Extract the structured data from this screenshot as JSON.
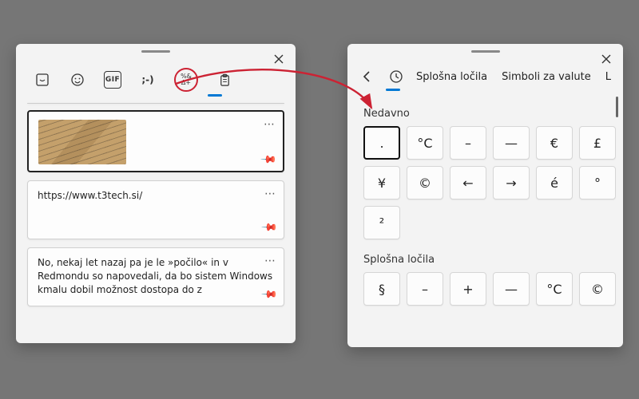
{
  "left": {
    "tabs": {
      "sticker": "❐",
      "emoji": "☺",
      "gif": "GIF",
      "kaomoji": ";-)",
      "symbols": "%&\nΔ+",
      "clipboard": "📋"
    },
    "clips": [
      {
        "type": "image"
      },
      {
        "type": "text",
        "text": "https://www.t3tech.si/"
      },
      {
        "type": "text",
        "text": "No, nekaj let nazaj pa je le »počilo« in v Redmondu so napovedali, da bo sistem Windows kmalu dobil možnost dostopa do z"
      }
    ]
  },
  "right": {
    "categories": [
      "Splošna ločila",
      "Simboli za valute",
      "L"
    ],
    "sections": [
      {
        "title": "Nedavno",
        "keys": [
          ".",
          "°C",
          "–",
          "—",
          "€",
          "£",
          "¥",
          "©",
          "←",
          "→",
          "é",
          "°",
          "²"
        ]
      },
      {
        "title": "Splošna ločila",
        "keys": [
          "§",
          "–",
          "+",
          "—",
          "°C",
          "©"
        ]
      }
    ]
  }
}
